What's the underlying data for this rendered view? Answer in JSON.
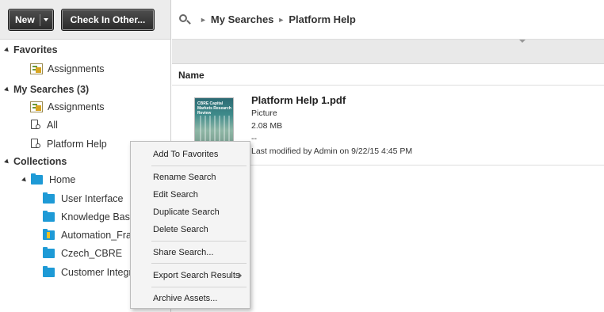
{
  "toolbar": {
    "new_label": "New",
    "checkin_label": "Check In Other..."
  },
  "tree": {
    "favorites": {
      "label": "Favorites",
      "items": [
        {
          "label": "Assignments"
        }
      ]
    },
    "my_searches": {
      "label": "My Searches (3)",
      "items": [
        {
          "label": "Assignments"
        },
        {
          "label": "All"
        },
        {
          "label": "Platform Help"
        }
      ]
    },
    "collections": {
      "label": "Collections",
      "home": "Home",
      "items": [
        {
          "label": "User Interface"
        },
        {
          "label": "Knowledge Base"
        },
        {
          "label": "Automation_Fram"
        },
        {
          "label": "Czech_CBRE"
        },
        {
          "label": "Customer Integra"
        }
      ]
    }
  },
  "breadcrumb": {
    "level1": "My Searches",
    "level2": "Platform Help"
  },
  "results": {
    "column_name": "Name",
    "asset": {
      "name": "Platform Help 1.pdf",
      "type": "Picture",
      "size": "2.08 MB",
      "extra": "--",
      "modified": "Last modified by Admin on 9/22/15 4:45 PM",
      "thumb_text": "CBRE Capital Markets Research Review"
    }
  },
  "context_menu": {
    "add_favorites": "Add To Favorites",
    "rename": "Rename Search",
    "edit": "Edit Search",
    "duplicate": "Duplicate Search",
    "delete": "Delete Search",
    "share": "Share Search...",
    "export": "Export Search Results",
    "archive": "Archive Assets..."
  }
}
